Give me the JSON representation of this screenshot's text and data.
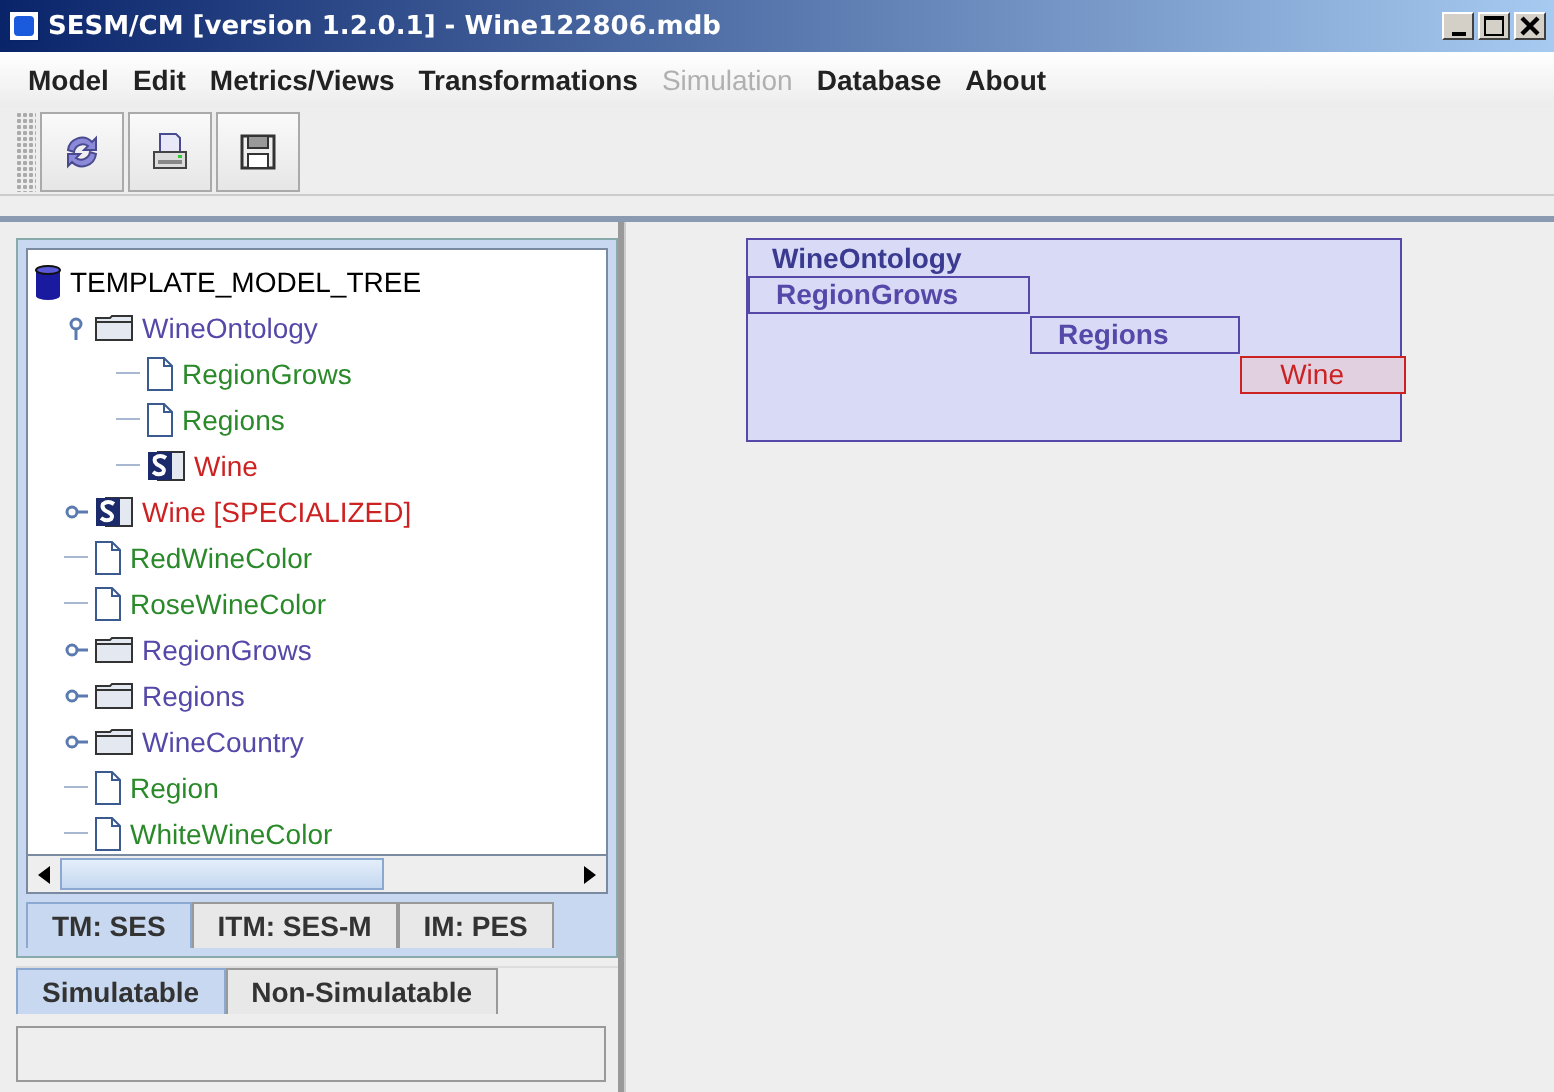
{
  "window": {
    "title": "SESM/CM [version 1.2.0.1] - Wine122806.mdb"
  },
  "menu": [
    {
      "label": "Model",
      "disabled": false
    },
    {
      "label": "Edit",
      "disabled": false
    },
    {
      "label": "Metrics/Views",
      "disabled": false
    },
    {
      "label": "Transformations",
      "disabled": false
    },
    {
      "label": "Simulation",
      "disabled": true
    },
    {
      "label": "Database",
      "disabled": false
    },
    {
      "label": "About",
      "disabled": false
    }
  ],
  "tree": {
    "label": "TEMPLATE_MODEL_TREE",
    "children": [
      {
        "label": "WineOntology",
        "kind": "folder",
        "color": "#5548a8",
        "expanded": true,
        "children": [
          {
            "label": "RegionGrows",
            "kind": "document",
            "color": "#2a8a2a"
          },
          {
            "label": "Regions",
            "kind": "document",
            "color": "#2a8a2a"
          },
          {
            "label": "Wine",
            "kind": "specialization",
            "color": "#cc2222"
          }
        ]
      },
      {
        "label": "Wine [SPECIALIZED]",
        "kind": "specialization",
        "color": "#cc2222",
        "expanded": false
      },
      {
        "label": "RedWineColor",
        "kind": "document",
        "color": "#2a8a2a"
      },
      {
        "label": "RoseWineColor",
        "kind": "document",
        "color": "#2a8a2a"
      },
      {
        "label": "RegionGrows",
        "kind": "folder",
        "color": "#5548a8",
        "expanded": false
      },
      {
        "label": "Regions",
        "kind": "folder",
        "color": "#5548a8",
        "expanded": false
      },
      {
        "label": "WineCountry",
        "kind": "folder",
        "color": "#5548a8",
        "expanded": false
      },
      {
        "label": "Region",
        "kind": "document",
        "color": "#2a8a2a"
      },
      {
        "label": "WhiteWineColor",
        "kind": "document",
        "color": "#2a8a2a"
      }
    ]
  },
  "model_tabs": [
    {
      "label": "TM: SES",
      "selected": true
    },
    {
      "label": "ITM: SES-M",
      "selected": false
    },
    {
      "label": "IM: PES",
      "selected": false
    }
  ],
  "sim_tabs": [
    {
      "label": "Simulatable",
      "selected": true
    },
    {
      "label": "Non-Simulatable",
      "selected": false
    }
  ],
  "diagram": {
    "root": "WineOntology",
    "blocks": [
      {
        "label": "RegionGrows",
        "color": "#5548a8"
      },
      {
        "label": "Regions",
        "color": "#5548a8"
      },
      {
        "label": "Wine",
        "color": "#cc2222"
      }
    ]
  }
}
